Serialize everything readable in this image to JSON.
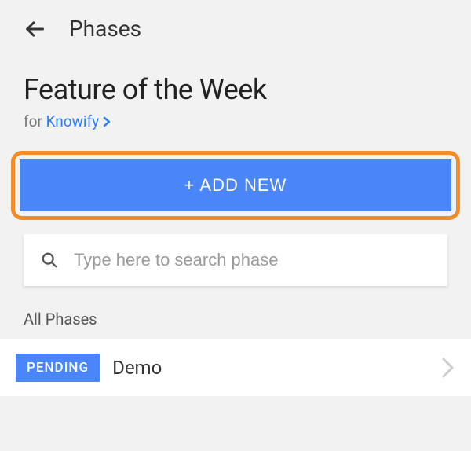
{
  "header": {
    "title": "Phases"
  },
  "feature": {
    "title": "Feature of the Week",
    "for_prefix": "for ",
    "project_link": "Knowify"
  },
  "add_button": {
    "label": "+ ADD NEW"
  },
  "search": {
    "placeholder": "Type here to search phase"
  },
  "sections": {
    "all_label": "All Phases"
  },
  "phases": [
    {
      "status": "PENDING",
      "name": "Demo"
    }
  ]
}
